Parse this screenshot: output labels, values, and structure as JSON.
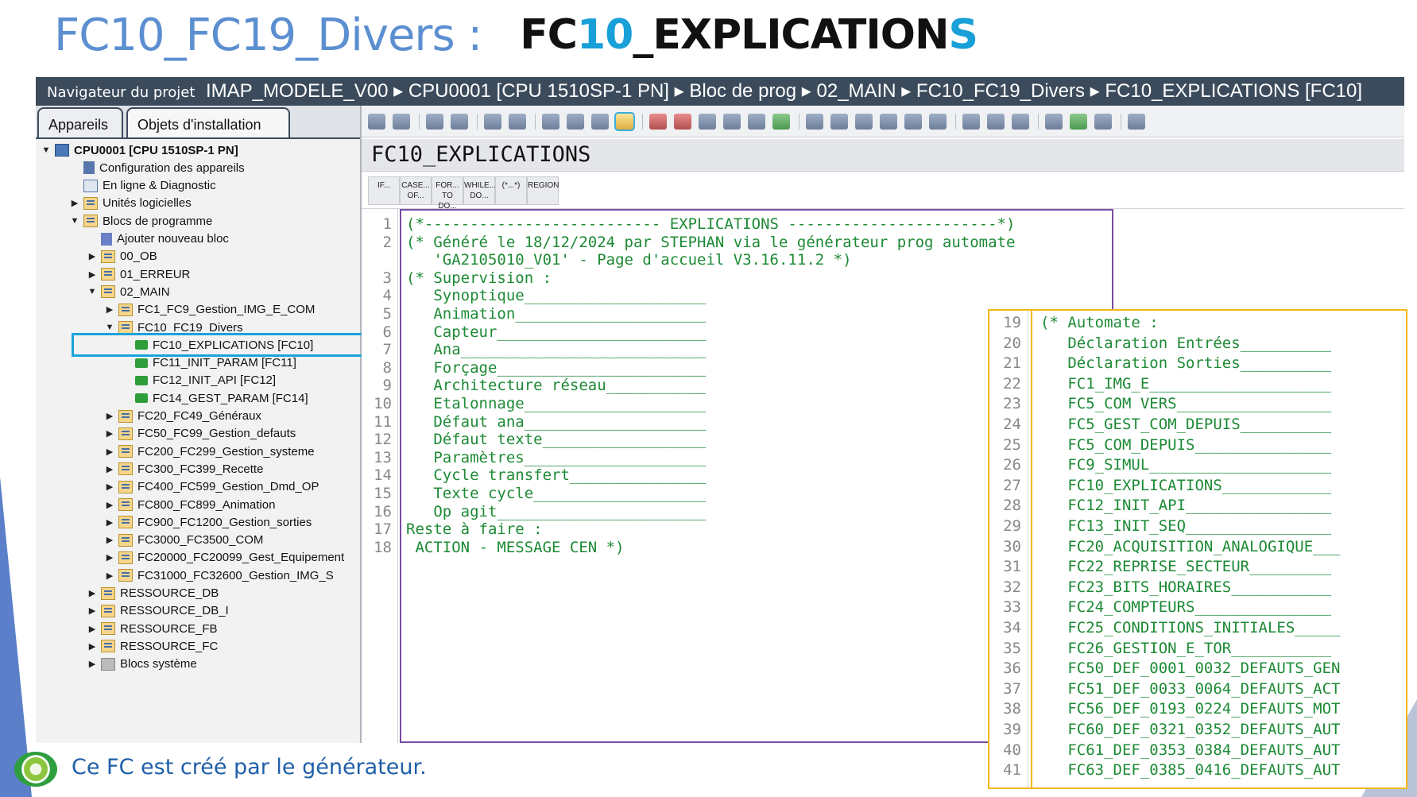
{
  "title": {
    "left": "FC10_FC19_Divers :",
    "right_prefix": "FC",
    "right_highlight": "10",
    "right_mid": "_EXPLICATION",
    "right_suffix": "S"
  },
  "topbar": {
    "navigator_label": "Navigateur du projet",
    "path": "IMAP_MODELE_V00 ▸ CPU0001 [CPU 1510SP-1 PN] ▸ Bloc de prog ▸ 02_MAIN ▸ FC10_FC19_Divers ▸ FC10_EXPLICATIONS [FC10]"
  },
  "tabs": [
    "Appareils",
    "Objets d'installation"
  ],
  "tree": [
    {
      "label": "CPU0001 [CPU 1510SP-1 PN]",
      "level": 0,
      "arrow": "▼",
      "icon": "cpu-icon",
      "bold": true
    },
    {
      "label": "Configuration des appareils",
      "level": 1,
      "arrow": "",
      "icon": "device-config-icon"
    },
    {
      "label": "En ligne & Diagnostic",
      "level": 1,
      "arrow": "",
      "icon": "online-diagnostic-icon"
    },
    {
      "label": "Unités logicielles",
      "level": 1,
      "arrow": "▶",
      "icon": "software-units-icon"
    },
    {
      "label": "Blocs de programme",
      "level": 1,
      "arrow": "▼",
      "icon": "program-blocks-icon"
    },
    {
      "label": "Ajouter nouveau bloc",
      "level": 2,
      "arrow": "",
      "icon": "add-block-icon"
    },
    {
      "label": "00_OB",
      "level": 2,
      "arrow": "▶",
      "icon": "folder-icon"
    },
    {
      "label": "01_ERREUR",
      "level": 2,
      "arrow": "▶",
      "icon": "folder-icon"
    },
    {
      "label": "02_MAIN",
      "level": 2,
      "arrow": "▼",
      "icon": "folder-icon"
    },
    {
      "label": "FC1_FC9_Gestion_IMG_E_COM",
      "level": 3,
      "arrow": "▶",
      "icon": "folder-icon"
    },
    {
      "label": "FC10_FC19_Divers",
      "level": 3,
      "arrow": "▼",
      "icon": "folder-icon"
    },
    {
      "label": "FC10_EXPLICATIONS [FC10]",
      "level": 4,
      "arrow": "",
      "icon": "fc-block-icon",
      "selected": true
    },
    {
      "label": "FC11_INIT_PARAM [FC11]",
      "level": 4,
      "arrow": "",
      "icon": "fc-block-icon"
    },
    {
      "label": "FC12_INIT_API [FC12]",
      "level": 4,
      "arrow": "",
      "icon": "fc-block-icon"
    },
    {
      "label": "FC14_GEST_PARAM [FC14]",
      "level": 4,
      "arrow": "",
      "icon": "fc-block-icon"
    },
    {
      "label": "FC20_FC49_Généraux",
      "level": 3,
      "arrow": "▶",
      "icon": "folder-icon"
    },
    {
      "label": "FC50_FC99_Gestion_defauts",
      "level": 3,
      "arrow": "▶",
      "icon": "folder-icon"
    },
    {
      "label": "FC200_FC299_Gestion_systeme",
      "level": 3,
      "arrow": "▶",
      "icon": "folder-icon"
    },
    {
      "label": "FC300_FC399_Recette",
      "level": 3,
      "arrow": "▶",
      "icon": "folder-icon"
    },
    {
      "label": "FC400_FC599_Gestion_Dmd_OP",
      "level": 3,
      "arrow": "▶",
      "icon": "folder-icon"
    },
    {
      "label": "FC800_FC899_Animation",
      "level": 3,
      "arrow": "▶",
      "icon": "folder-icon"
    },
    {
      "label": "FC900_FC1200_Gestion_sorties",
      "level": 3,
      "arrow": "▶",
      "icon": "folder-icon"
    },
    {
      "label": "FC3000_FC3500_COM",
      "level": 3,
      "arrow": "▶",
      "icon": "folder-icon"
    },
    {
      "label": "FC20000_FC20099_Gest_Equipement",
      "level": 3,
      "arrow": "▶",
      "icon": "folder-icon"
    },
    {
      "label": "FC31000_FC32600_Gestion_IMG_S",
      "level": 3,
      "arrow": "▶",
      "icon": "folder-icon"
    },
    {
      "label": "RESSOURCE_DB",
      "level": 2,
      "arrow": "▶",
      "icon": "folder-icon"
    },
    {
      "label": "RESSOURCE_DB_I",
      "level": 2,
      "arrow": "▶",
      "icon": "folder-icon"
    },
    {
      "label": "RESSOURCE_FB",
      "level": 2,
      "arrow": "▶",
      "icon": "folder-icon"
    },
    {
      "label": "RESSOURCE_FC",
      "level": 2,
      "arrow": "▶",
      "icon": "folder-icon"
    },
    {
      "label": "Blocs système",
      "level": 2,
      "arrow": "▶",
      "icon": "system-blocks-icon"
    }
  ],
  "editor": {
    "block_name": "FC10_EXPLICATIONS",
    "snippets": [
      {
        "line1": "IF...",
        "line2": ""
      },
      {
        "line1": "CASE...",
        "line2": "OF..."
      },
      {
        "line1": "FOR...",
        "line2": "TO DO..."
      },
      {
        "line1": "WHILE...",
        "line2": "DO..."
      },
      {
        "line1": "(*...*)",
        "line2": ""
      },
      {
        "line1": "REGION",
        "line2": ""
      }
    ]
  },
  "code_main": [
    {
      "n": "1",
      "text": "(*-------------------------- EXPLICATIONS -----------------------*)"
    },
    {
      "n": "2",
      "text": "(* Généré le 18/12/2024 par STEPHAN via le générateur prog automate"
    },
    {
      "n": "",
      "text": "   'GA2105010_V01' - Page d'accueil V3.16.11.2 *)"
    },
    {
      "n": "3",
      "text": "(* Supervision :"
    },
    {
      "n": "4",
      "text": "   Synoptique____________________"
    },
    {
      "n": "5",
      "text": "   Animation_____________________"
    },
    {
      "n": "6",
      "text": "   Capteur_______________________"
    },
    {
      "n": "7",
      "text": "   Ana___________________________"
    },
    {
      "n": "8",
      "text": "   Forçage_______________________"
    },
    {
      "n": "9",
      "text": "   Architecture réseau___________"
    },
    {
      "n": "10",
      "text": "   Etalonnage____________________"
    },
    {
      "n": "11",
      "text": "   Défaut ana____________________"
    },
    {
      "n": "12",
      "text": "   Défaut texte__________________"
    },
    {
      "n": "13",
      "text": "   Paramètres____________________"
    },
    {
      "n": "14",
      "text": "   Cycle transfert_______________"
    },
    {
      "n": "15",
      "text": "   Texte cycle___________________"
    },
    {
      "n": "16",
      "text": "   Op agit_______________________"
    },
    {
      "n": "17",
      "text": "Reste à faire :"
    },
    {
      "n": "18",
      "text": " ACTION - MESSAGE CEN *)"
    }
  ],
  "code_overlay": [
    {
      "n": "19",
      "text": "(* Automate :"
    },
    {
      "n": "20",
      "text": "   Déclaration Entrées__________"
    },
    {
      "n": "21",
      "text": "   Déclaration Sorties__________"
    },
    {
      "n": "22",
      "text": "   FC1_IMG_E____________________"
    },
    {
      "n": "23",
      "text": "   FC5_COM VERS_________________"
    },
    {
      "n": "24",
      "text": "   FC5_GEST_COM_DEPUIS__________"
    },
    {
      "n": "25",
      "text": "   FC5_COM_DEPUIS_______________"
    },
    {
      "n": "26",
      "text": "   FC9_SIMUL____________________"
    },
    {
      "n": "27",
      "text": "   FC10_EXPLICATIONS____________"
    },
    {
      "n": "28",
      "text": "   FC12_INIT_API________________"
    },
    {
      "n": "29",
      "text": "   FC13_INIT_SEQ________________"
    },
    {
      "n": "30",
      "text": "   FC20_ACQUISITION_ANALOGIQUE___"
    },
    {
      "n": "31",
      "text": "   FC22_REPRISE_SECTEUR_________"
    },
    {
      "n": "32",
      "text": "   FC23_BITS_HORAIRES___________"
    },
    {
      "n": "33",
      "text": "   FC24_COMPTEURS_______________"
    },
    {
      "n": "34",
      "text": "   FC25_CONDITIONS_INITIALES_____"
    },
    {
      "n": "35",
      "text": "   FC26_GESTION_E_TOR___________"
    },
    {
      "n": "36",
      "text": "   FC50_DEF_0001_0032_DEFAUTS_GEN"
    },
    {
      "n": "37",
      "text": "   FC51_DEF_0033_0064_DEFAUTS_ACT"
    },
    {
      "n": "38",
      "text": "   FC56_DEF_0193_0224_DEFAUTS_MOT"
    },
    {
      "n": "39",
      "text": "   FC60_DEF_0321_0352_DEFAUTS_AUT"
    },
    {
      "n": "40",
      "text": "   FC61_DEF_0353_0384_DEFAUTS_AUT"
    },
    {
      "n": "41",
      "text": "   FC63_DEF_0385_0416_DEFAUTS_AUT"
    }
  ],
  "footer": {
    "text": "Ce FC est créé par le générateur."
  },
  "colors": {
    "code": "#1d8a35",
    "title_blue": "#5b8fd0",
    "highlight_cyan": "#1aa3dc",
    "overlay_border": "#f2b818",
    "header_bar": "#3c4b5c"
  }
}
